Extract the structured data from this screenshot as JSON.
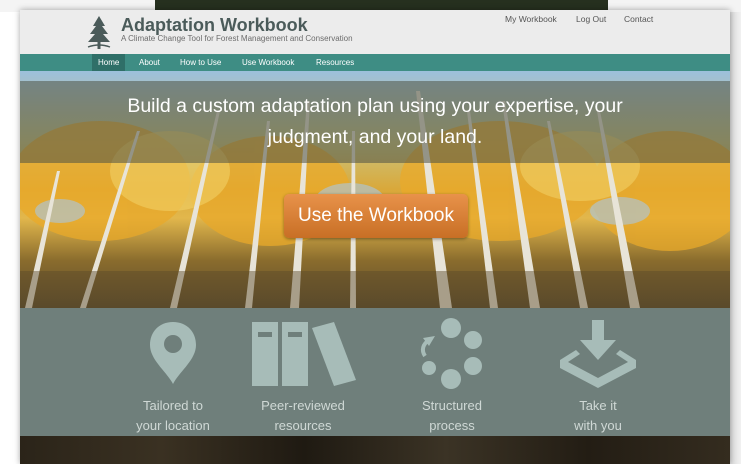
{
  "header": {
    "title": "Adaptation Workbook",
    "subtitle": "A Climate Change Tool for Forest Management and Conservation",
    "utility_links": [
      "My Workbook",
      "Log Out",
      "Contact"
    ]
  },
  "nav": {
    "items": [
      "Home",
      "About",
      "How to Use",
      "Use Workbook",
      "Resources"
    ],
    "active": "Home"
  },
  "hero": {
    "headline_line1": "Build a custom adaptation plan using your expertise, your",
    "headline_line2": "judgment, and your land.",
    "cta_label": "Use the Workbook"
  },
  "features": [
    {
      "icon": "location-pin-icon",
      "line1": "Tailored to",
      "line2": "your location"
    },
    {
      "icon": "books-icon",
      "line1": "Peer-reviewed",
      "line2": "resources"
    },
    {
      "icon": "cycle-icon",
      "line1": "Structured",
      "line2": "process"
    },
    {
      "icon": "download-tray-icon",
      "line1": "Take it",
      "line2": "with you"
    }
  ],
  "colors": {
    "nav_bg": "#3e8d84",
    "cta_bg": "#d97c34",
    "features_bg": "#6f7f7b",
    "header_bg": "#ececec"
  }
}
